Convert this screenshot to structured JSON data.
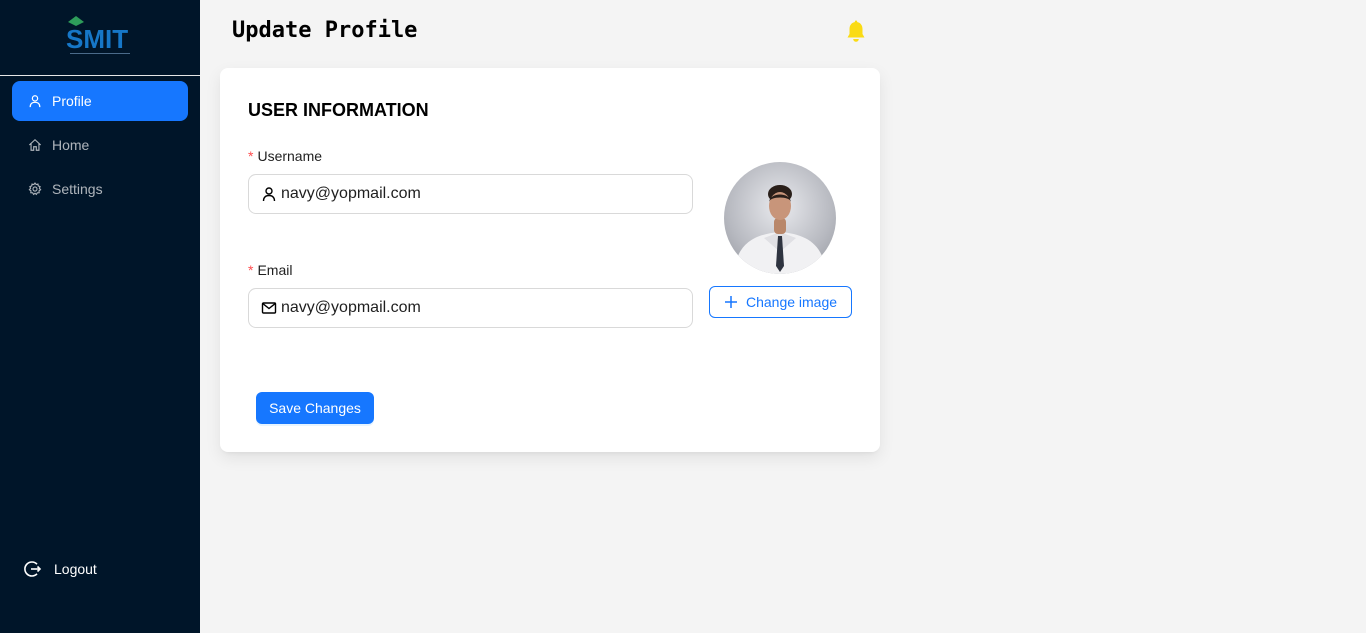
{
  "logo": {
    "text": "SMIT"
  },
  "sidebar": {
    "items": [
      {
        "label": "Profile",
        "icon": "user-icon",
        "active": true
      },
      {
        "label": "Home",
        "icon": "home-icon",
        "active": false
      },
      {
        "label": "Settings",
        "icon": "gear-icon",
        "active": false
      }
    ],
    "logout_label": "Logout"
  },
  "header": {
    "title": "Update Profile",
    "bell_icon": "bell-icon"
  },
  "form": {
    "section_title": "USER INFORMATION",
    "username": {
      "label": "Username",
      "value": "navy@yopmail.com",
      "required_mark": "*"
    },
    "email": {
      "label": "Email",
      "value": "navy@yopmail.com",
      "required_mark": "*"
    },
    "change_image_label": "Change image",
    "save_label": "Save Changes"
  },
  "colors": {
    "sidebar_bg": "#001529",
    "accent": "#1677ff",
    "bell": "#fadb14",
    "required": "#ff4d4f"
  }
}
